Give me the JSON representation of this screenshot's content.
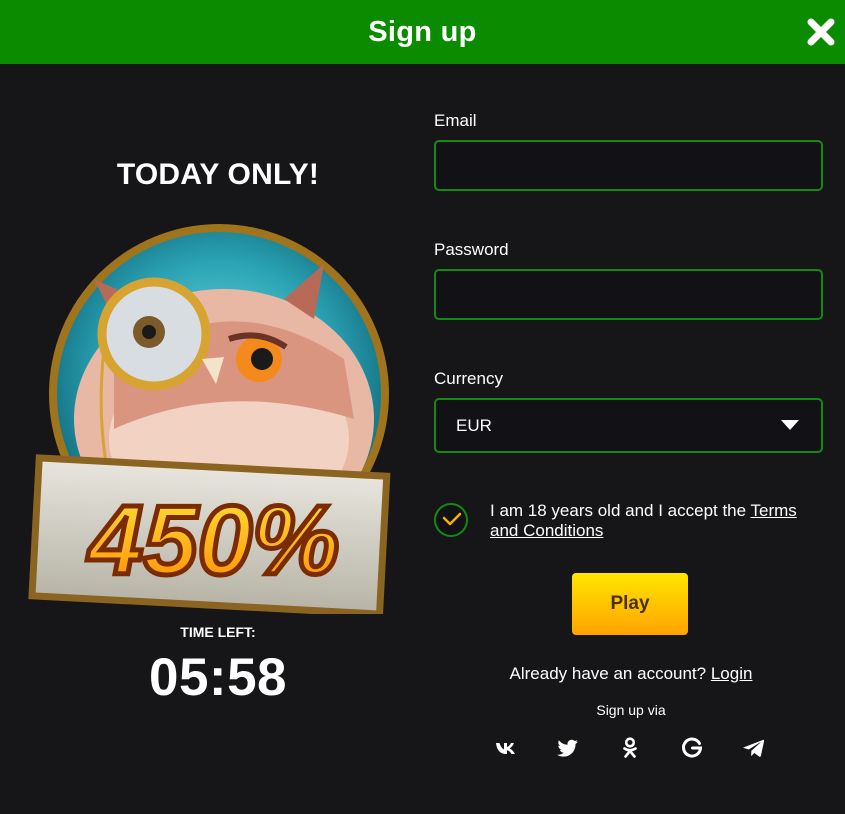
{
  "header": {
    "title": "Sign up",
    "close_icon": "close-icon"
  },
  "promo": {
    "headline": "TODAY ONLY!",
    "bonus": "450%",
    "time_left_label": "TIME LEFT:",
    "timer": "05:58"
  },
  "form": {
    "email_label": "Email",
    "email_value": "",
    "password_label": "Password",
    "password_value": "",
    "currency_label": "Currency",
    "currency_value": "EUR",
    "terms_text": "I am 18 years old and I accept the ",
    "terms_link": "Terms and Conditions",
    "terms_checked": true,
    "play_label": "Play"
  },
  "footer": {
    "account_text": "Already have an account? ",
    "login_link": "Login",
    "signup_via": "Sign up via",
    "social": [
      "vk-icon",
      "twitter-icon",
      "odnoklassniki-icon",
      "google-icon",
      "telegram-icon"
    ]
  },
  "colors": {
    "header_bg": "#0b8c00",
    "page_bg": "#161618",
    "input_border": "#138a12",
    "play_gradient_top": "#ffe600",
    "play_gradient_bottom": "#ffa300",
    "check_mark": "#f5b000"
  }
}
